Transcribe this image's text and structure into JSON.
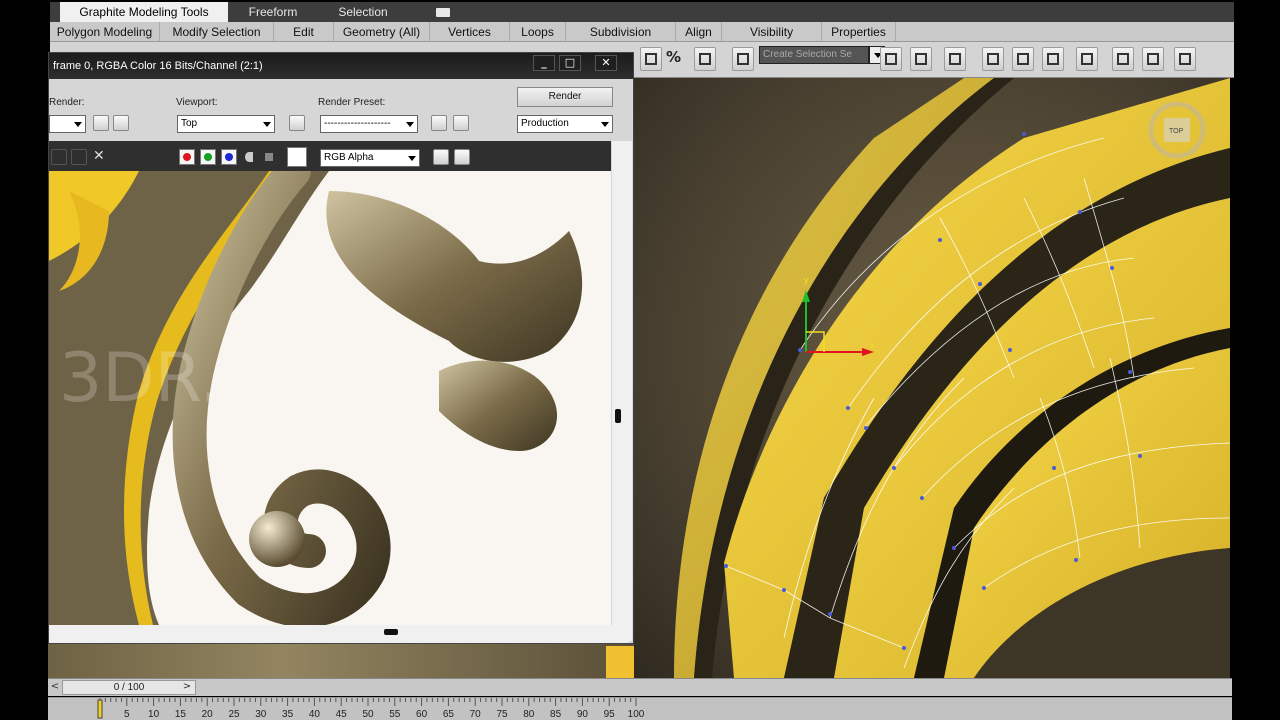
{
  "ribbon": {
    "tabs": [
      "Graphite Modeling Tools",
      "Freeform",
      "Selection"
    ]
  },
  "subribbon": {
    "tabs": [
      "Polygon Modeling",
      "Modify Selection",
      "Edit",
      "Geometry (All)",
      "Vertices",
      "Loops",
      "Subdivision",
      "Align",
      "Visibility",
      "Properties"
    ]
  },
  "toolbar": {
    "selection_set_placeholder": "Create Selection Se",
    "percent_label": "%"
  },
  "frame_window": {
    "title": "frame 0, RGBA Color 16 Bits/Channel (2:1)",
    "render_label": "Render:",
    "viewport_label": "Viewport:",
    "viewport_value": "Top",
    "preset_label": "Render Preset:",
    "preset_value": "--------------------",
    "render_button": "Render",
    "production_value": "Production",
    "channel_value": "RGB Alpha",
    "watermark": "3DR.3D.RU"
  },
  "viewcube": {
    "face_label": "TOP"
  },
  "gizmo": {
    "x_label": "x",
    "y_label": "y"
  },
  "timeslider": {
    "frame_display": "0 / 100",
    "current_frame": 0,
    "total_frames": 100
  },
  "trackbar": {
    "ticks": [
      "5",
      "10",
      "15",
      "20",
      "25",
      "30",
      "35",
      "40",
      "45",
      "50",
      "55",
      "60",
      "65",
      "70",
      "75",
      "80",
      "85",
      "90",
      "95",
      "100"
    ]
  },
  "colors": {
    "model_yellow": "#e8c93a",
    "ribbon_active": "#f0f0f0",
    "gizmo_x": "#e0141c",
    "gizmo_y": "#1fbf2c"
  }
}
